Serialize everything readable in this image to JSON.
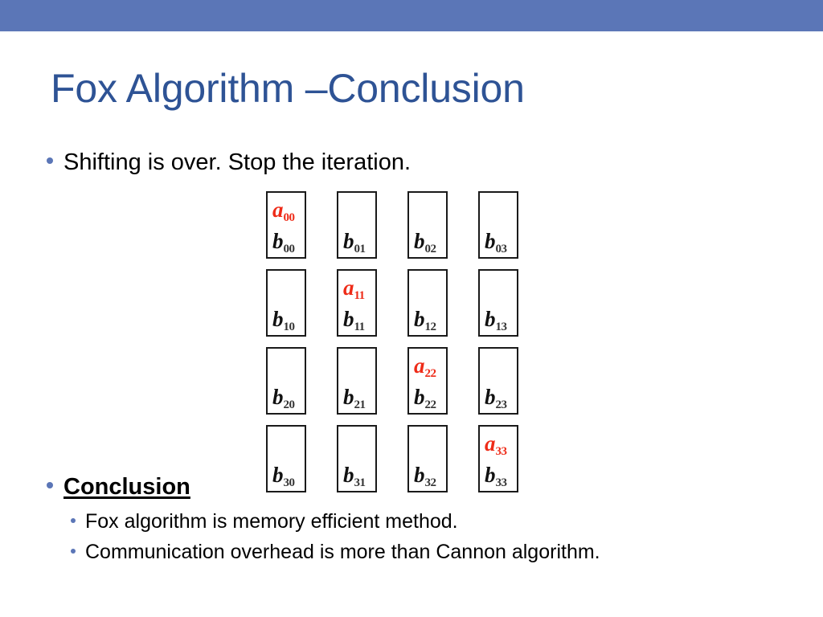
{
  "slide": {
    "title": "Fox Algorithm –Conclusion",
    "accent_band_color": "#5B76B7",
    "title_color": "#2E5395",
    "bullet_color": "#5B76B7",
    "highlight_color": "#EE2B18"
  },
  "bullets": {
    "shifting": "Shifting is over. Stop the iteration.",
    "conclusion_heading": "Conclusion",
    "sub": [
      "Fox algorithm is memory efficient method.",
      "Communication overhead is more than Cannon algorithm."
    ]
  },
  "matrix": {
    "rows": 4,
    "cols": 4,
    "cells": [
      [
        {
          "a": "a",
          "a_sub": "00",
          "b": "b",
          "b_sub": "00"
        },
        {
          "a": "",
          "a_sub": "",
          "b": "b",
          "b_sub": "01"
        },
        {
          "a": "",
          "a_sub": "",
          "b": "b",
          "b_sub": "02"
        },
        {
          "a": "",
          "a_sub": "",
          "b": "b",
          "b_sub": "03"
        }
      ],
      [
        {
          "a": "",
          "a_sub": "",
          "b": "b",
          "b_sub": "10"
        },
        {
          "a": "a",
          "a_sub": "11",
          "b": "b",
          "b_sub": "11"
        },
        {
          "a": "",
          "a_sub": "",
          "b": "b",
          "b_sub": "12"
        },
        {
          "a": "",
          "a_sub": "",
          "b": "b",
          "b_sub": "13"
        }
      ],
      [
        {
          "a": "",
          "a_sub": "",
          "b": "b",
          "b_sub": "20"
        },
        {
          "a": "",
          "a_sub": "",
          "b": "b",
          "b_sub": "21"
        },
        {
          "a": "a",
          "a_sub": "22",
          "b": "b",
          "b_sub": "22"
        },
        {
          "a": "",
          "a_sub": "",
          "b": "b",
          "b_sub": "23"
        }
      ],
      [
        {
          "a": "",
          "a_sub": "",
          "b": "b",
          "b_sub": "30"
        },
        {
          "a": "",
          "a_sub": "",
          "b": "b",
          "b_sub": "31"
        },
        {
          "a": "",
          "a_sub": "",
          "b": "b",
          "b_sub": "32"
        },
        {
          "a": "a",
          "a_sub": "33",
          "b": "b",
          "b_sub": "33"
        }
      ]
    ]
  }
}
